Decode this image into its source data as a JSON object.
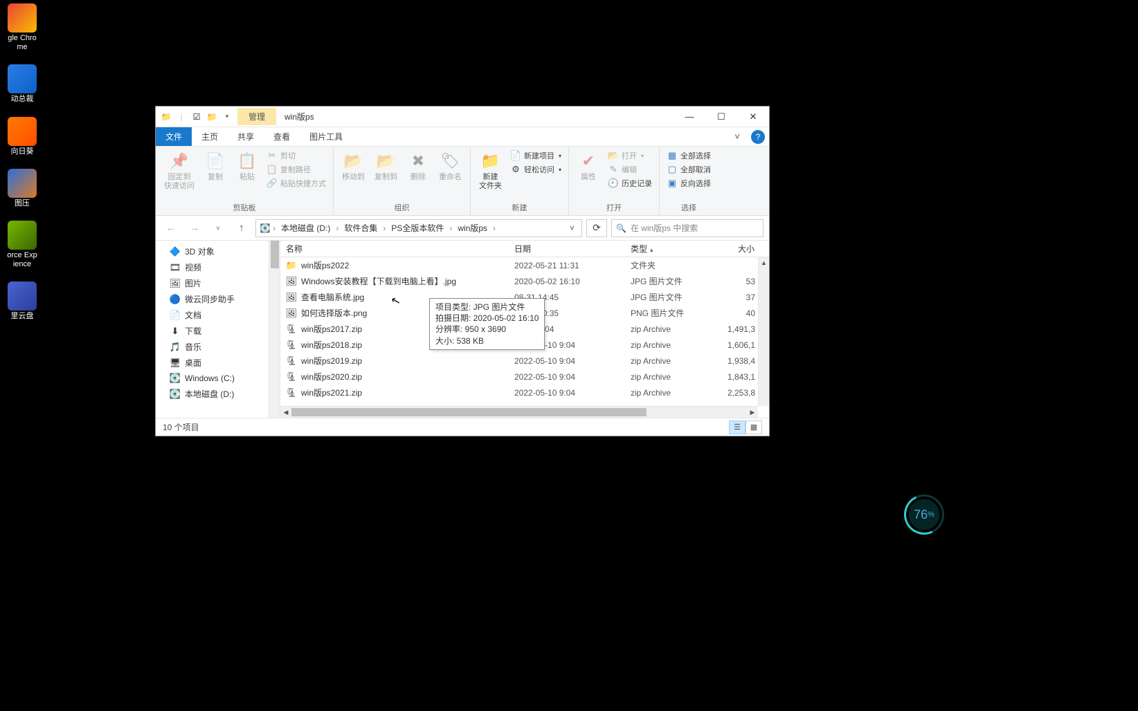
{
  "desktop": {
    "icons": [
      {
        "label": "gle Chro\nme",
        "color": "#fff",
        "bgStart": "#E94435",
        "bgEnd": "#FBBC05"
      },
      {
        "label": "动总裁",
        "color": "#fff",
        "bgStart": "#2B7FE3",
        "bgEnd": "#0B5FC7"
      },
      {
        "label": "向日葵",
        "color": "#fff",
        "bgStart": "#FF7A00",
        "bgEnd": "#FF4E00"
      },
      {
        "label": "图压",
        "color": "#fff",
        "bgStart": "#2E6FD6",
        "bgEnd": "#D97A2A"
      },
      {
        "label": "orce Exp\nience",
        "color": "#fff",
        "bgStart": "#76B900",
        "bgEnd": "#3E6400"
      },
      {
        "label": "里云盘",
        "color": "#fff",
        "bgStart": "#4A63D0",
        "bgEnd": "#2C3F9C"
      }
    ]
  },
  "window": {
    "title": "win版ps",
    "manageTab": "管理",
    "tabs": {
      "file": "文件",
      "home": "主页",
      "share": "共享",
      "view": "查看",
      "pictureTools": "图片工具"
    }
  },
  "ribbon": {
    "clipboard": {
      "group": "剪贴板",
      "pin": "固定到\n快速访问",
      "copy": "复制",
      "paste": "粘贴",
      "cut": "剪切",
      "copyPath": "复制路径",
      "pasteShortcut": "粘贴快捷方式"
    },
    "organize": {
      "group": "组织",
      "moveTo": "移动到",
      "copyTo": "复制到",
      "delete": "删除",
      "rename": "重命名"
    },
    "new_": {
      "group": "新建",
      "newFolder": "新建\n文件夹",
      "newItem": "新建项目",
      "easyAccess": "轻松访问"
    },
    "open_": {
      "group": "打开",
      "properties": "属性",
      "open": "打开",
      "edit": "编辑",
      "history": "历史记录"
    },
    "select_": {
      "group": "选择",
      "selectAll": "全部选择",
      "selectNone": "全部取消",
      "invert": "反向选择"
    }
  },
  "breadcrumb": {
    "items": [
      "本地磁盘 (D:)",
      "软件合集",
      "PS全版本软件",
      "win版ps"
    ]
  },
  "search": {
    "placeholder": "在 win版ps 中搜索"
  },
  "navpane": {
    "items": [
      {
        "label": "3D 对象",
        "ico": "🔷"
      },
      {
        "label": "视频",
        "ico": "🎞"
      },
      {
        "label": "图片",
        "ico": "🖼"
      },
      {
        "label": "微云同步助手",
        "ico": "🔵"
      },
      {
        "label": "文档",
        "ico": "📄"
      },
      {
        "label": "下载",
        "ico": "⬇"
      },
      {
        "label": "音乐",
        "ico": "🎵"
      },
      {
        "label": "桌面",
        "ico": "🖥"
      },
      {
        "label": "Windows (C:)",
        "ico": "💽"
      },
      {
        "label": "本地磁盘 (D:)",
        "ico": "💽"
      }
    ]
  },
  "columns": {
    "name": "名称",
    "date": "日期",
    "type": "类型",
    "size": "大小"
  },
  "files": [
    {
      "ico": "📁",
      "name": "win版ps2022",
      "date": "2022-05-21 11:31",
      "type": "文件夹",
      "size": ""
    },
    {
      "ico": "🖼",
      "name": "Windows安装教程【下载到电脑上看】.jpg",
      "date": "2020-05-02 16:10",
      "type": "JPG 图片文件",
      "size": "53"
    },
    {
      "ico": "🖼",
      "name": "查看电脑系统.jpg",
      "date": "08-31 14:45",
      "type": "JPG 图片文件",
      "size": "37"
    },
    {
      "ico": "🖼",
      "name": "如何选择版本.png",
      "date": "05-03 10:35",
      "type": "PNG 图片文件",
      "size": "40"
    },
    {
      "ico": "🗜",
      "name": "win版ps2017.zip",
      "date": "05-10 9:04",
      "type": "zip Archive",
      "size": "1,491,3"
    },
    {
      "ico": "🗜",
      "name": "win版ps2018.zip",
      "date": "2022-05-10 9:04",
      "type": "zip Archive",
      "size": "1,606,1"
    },
    {
      "ico": "🗜",
      "name": "win版ps2019.zip",
      "date": "2022-05-10 9:04",
      "type": "zip Archive",
      "size": "1,938,4"
    },
    {
      "ico": "🗜",
      "name": "win版ps2020.zip",
      "date": "2022-05-10 9:04",
      "type": "zip Archive",
      "size": "1,843,1"
    },
    {
      "ico": "🗜",
      "name": "win版ps2021.zip",
      "date": "2022-05-10 9:04",
      "type": "zip Archive",
      "size": "2,253,8"
    }
  ],
  "tooltip": {
    "line1": "项目类型: JPG 图片文件",
    "line2": "拍摄日期: 2020-05-02 16:10",
    "line3": "分辨率: 950 x 3690",
    "line4": "大小: 538 KB"
  },
  "status": {
    "text": "10 个项目"
  },
  "indicator": {
    "value": "76",
    "suffix": "%"
  }
}
